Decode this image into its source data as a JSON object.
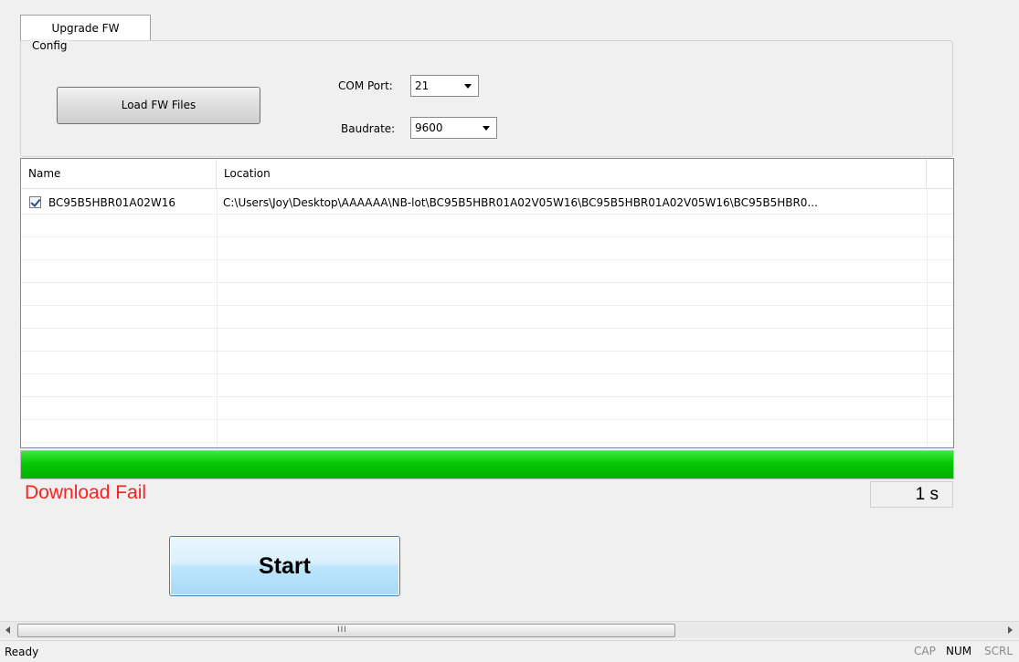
{
  "tab": {
    "label": "Upgrade FW"
  },
  "config": {
    "group_title": "Config",
    "load_button": "Load FW Files",
    "com_port_label": "COM Port:",
    "com_port_value": "21",
    "baudrate_label": "Baudrate:",
    "baudrate_value": "9600"
  },
  "file_list": {
    "columns": [
      "Name",
      "Location"
    ],
    "rows": [
      {
        "checked": true,
        "name": "BC95B5HBR01A02W16",
        "location": "C:\\Users\\Joy\\Desktop\\AAAAAA\\NB-lot\\BC95B5HBR01A02V05W16\\BC95B5HBR01A02V05W16\\BC95B5HBR0..."
      }
    ]
  },
  "progress": {
    "percent": 100,
    "color": "#06c806"
  },
  "status": {
    "message": "Download Fail",
    "message_color": "#ff2020",
    "elapsed": "1 s"
  },
  "start_button": "Start",
  "scrollbar": {
    "grip": "III"
  },
  "statusbar": {
    "text": "Ready",
    "indicators": [
      "CAP",
      "NUM",
      "SCRL"
    ]
  }
}
